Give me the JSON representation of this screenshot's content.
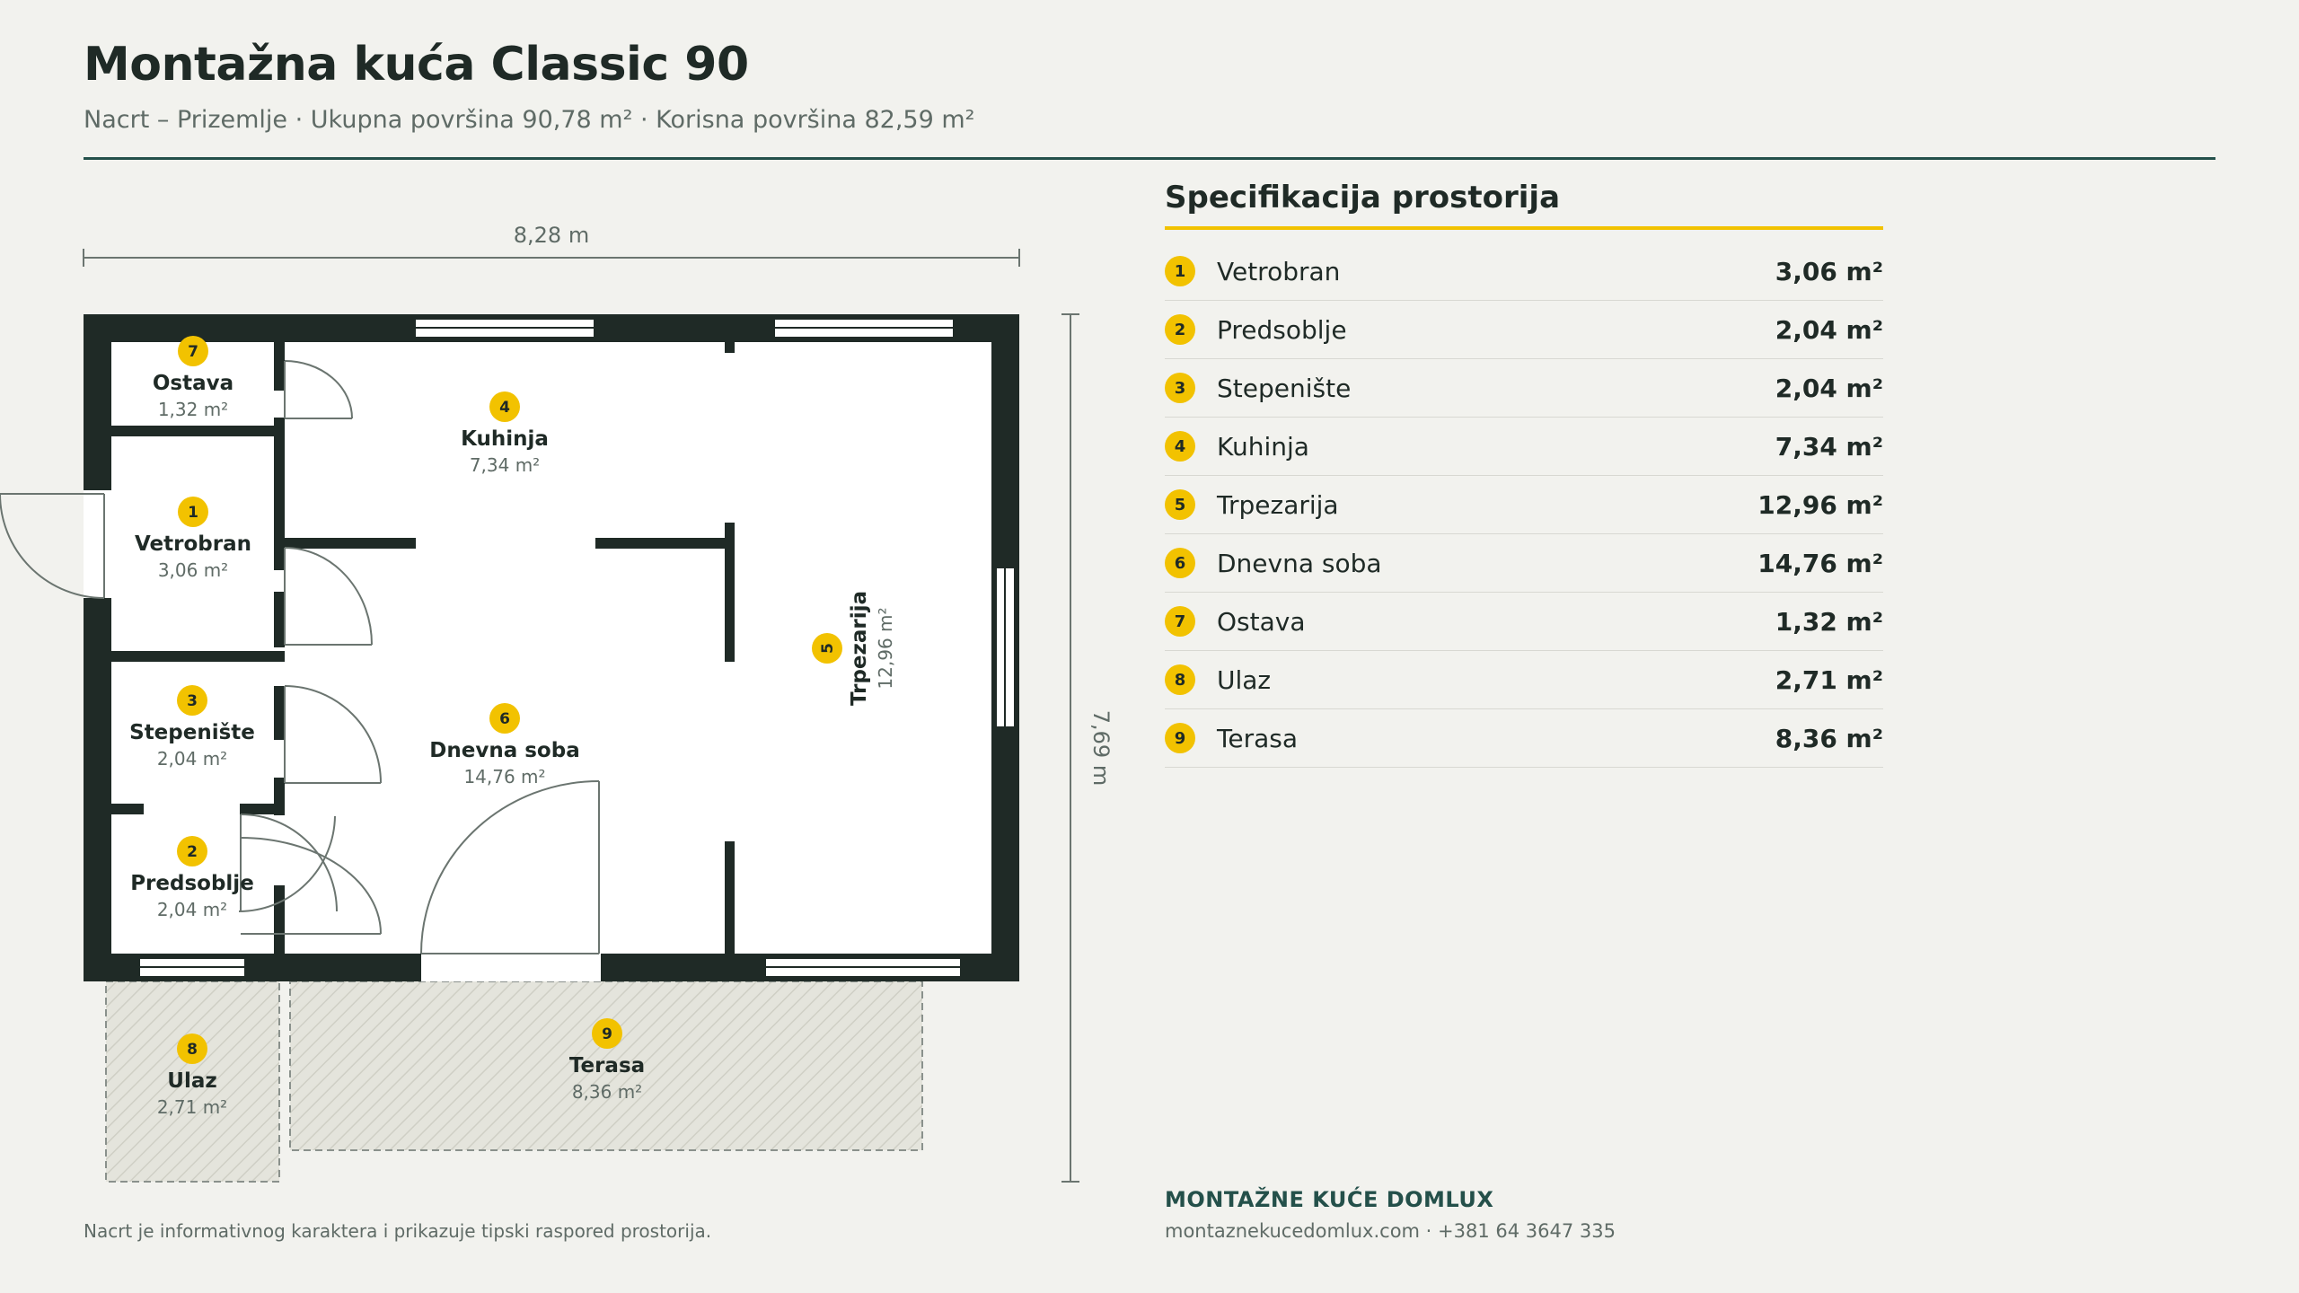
{
  "header": {
    "title": "Montažna kuća Classic 90",
    "subtitle": "Nacrt – Prizemlje · Ukupna površina 90,78 m² · Korisna površina 82,59 m²"
  },
  "plan": {
    "width_label": "8,28 m",
    "height_label": "7,69 m",
    "rooms": [
      {
        "num": "1",
        "name": "Vetrobran",
        "area": "3,06 m²"
      },
      {
        "num": "2",
        "name": "Predsoblje",
        "area": "2,04 m²"
      },
      {
        "num": "3",
        "name": "Stepenište",
        "area": "2,04 m²"
      },
      {
        "num": "4",
        "name": "Kuhinja",
        "area": "7,34 m²"
      },
      {
        "num": "5",
        "name": "Trpezarija",
        "area": "12,96 m²"
      },
      {
        "num": "6",
        "name": "Dnevna soba",
        "area": "14,76 m²"
      },
      {
        "num": "7",
        "name": "Ostava",
        "area": "1,32 m²"
      },
      {
        "num": "8",
        "name": "Ulaz",
        "area": "2,71 m²"
      },
      {
        "num": "9",
        "name": "Terasa",
        "area": "8,36 m²"
      }
    ]
  },
  "spec": {
    "title": "Specifikacija prostorija",
    "rows": [
      {
        "num": "1",
        "name": "Vetrobran",
        "area": "3,06 m²"
      },
      {
        "num": "2",
        "name": "Predsoblje",
        "area": "2,04 m²"
      },
      {
        "num": "3",
        "name": "Stepenište",
        "area": "2,04 m²"
      },
      {
        "num": "4",
        "name": "Kuhinja",
        "area": "7,34 m²"
      },
      {
        "num": "5",
        "name": "Trpezarija",
        "area": "12,96 m²"
      },
      {
        "num": "6",
        "name": "Dnevna soba",
        "area": "14,76 m²"
      },
      {
        "num": "7",
        "name": "Ostava",
        "area": "1,32 m²"
      },
      {
        "num": "8",
        "name": "Ulaz",
        "area": "2,71 m²"
      },
      {
        "num": "9",
        "name": "Terasa",
        "area": "8,36 m²"
      }
    ]
  },
  "footer": {
    "company": "MONTAŽNE KUĆE DOMLUX",
    "contact": "montaznekucedomlux.com · +381 64 3647 335",
    "note": "Nacrt je informativnog karaktera i prikazuje tipski raspored prostorija."
  },
  "colors": {
    "wall": "#1f2a26",
    "accent": "#f2c200",
    "brand": "#24504a",
    "background": "#f2f2ee"
  }
}
